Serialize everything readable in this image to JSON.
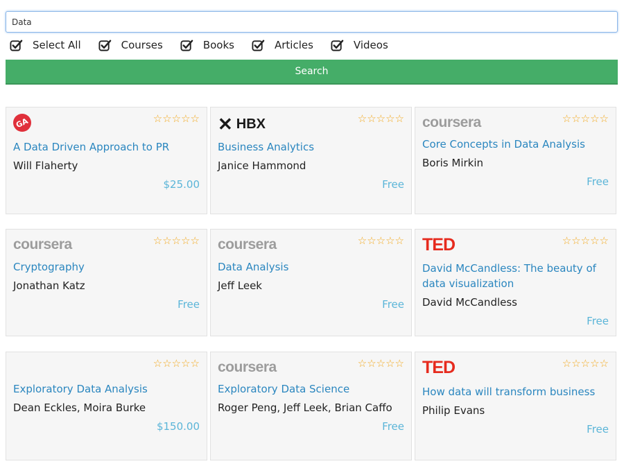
{
  "search": {
    "value": "Data",
    "button_label": "Search"
  },
  "filters": [
    {
      "label": "Select All",
      "checked": true
    },
    {
      "label": "Courses",
      "checked": true
    },
    {
      "label": "Books",
      "checked": true
    },
    {
      "label": "Articles",
      "checked": true
    },
    {
      "label": "Videos",
      "checked": true
    }
  ],
  "colors": {
    "accent": "#45ad68",
    "link": "#2a86bf",
    "price": "#5bb5d8",
    "star": "#f2a81d"
  },
  "cards": [
    {
      "provider": "GA",
      "logo_icon": "ga-logo-icon",
      "stars": "☆☆☆☆☆",
      "title": "A Data Driven Approach to PR",
      "author": "Will Flaherty",
      "price": "$25.00"
    },
    {
      "provider": "HBX",
      "logo_icon": "hbx-logo-icon",
      "stars": "☆☆☆☆☆",
      "title": "Business Analytics",
      "author": "Janice Hammond",
      "price": "Free"
    },
    {
      "provider": "coursera",
      "logo_icon": "coursera-logo-icon",
      "stars": "☆☆☆☆☆",
      "title": "Core Concepts in Data Analysis",
      "author": "Boris Mirkin",
      "price": "Free"
    },
    {
      "provider": "coursera",
      "logo_icon": "coursera-logo-icon",
      "stars": "☆☆☆☆☆",
      "title": "Cryptography",
      "author": "Jonathan Katz",
      "price": "Free"
    },
    {
      "provider": "coursera",
      "logo_icon": "coursera-logo-icon",
      "stars": "☆☆☆☆☆",
      "title": "Data Analysis",
      "author": "Jeff Leek",
      "price": "Free"
    },
    {
      "provider": "TED",
      "logo_icon": "ted-logo-icon",
      "stars": "☆☆☆☆☆",
      "title": "David McCandless: The beauty of data visualization",
      "author": "David McCandless",
      "price": "Free"
    },
    {
      "provider": "",
      "logo_icon": "",
      "stars": "☆☆☆☆☆",
      "title": "Exploratory Data Analysis",
      "author": "Dean Eckles, Moira Burke",
      "price": "$150.00"
    },
    {
      "provider": "coursera",
      "logo_icon": "coursera-logo-icon",
      "stars": "☆☆☆☆☆",
      "title": "Exploratory Data Science",
      "author": "Roger Peng, Jeff Leek, Brian Caffo",
      "price": "Free"
    },
    {
      "provider": "TED",
      "logo_icon": "ted-logo-icon",
      "stars": "☆☆☆☆☆",
      "title": "How data will transform business",
      "author": "Philip Evans",
      "price": "Free"
    }
  ]
}
